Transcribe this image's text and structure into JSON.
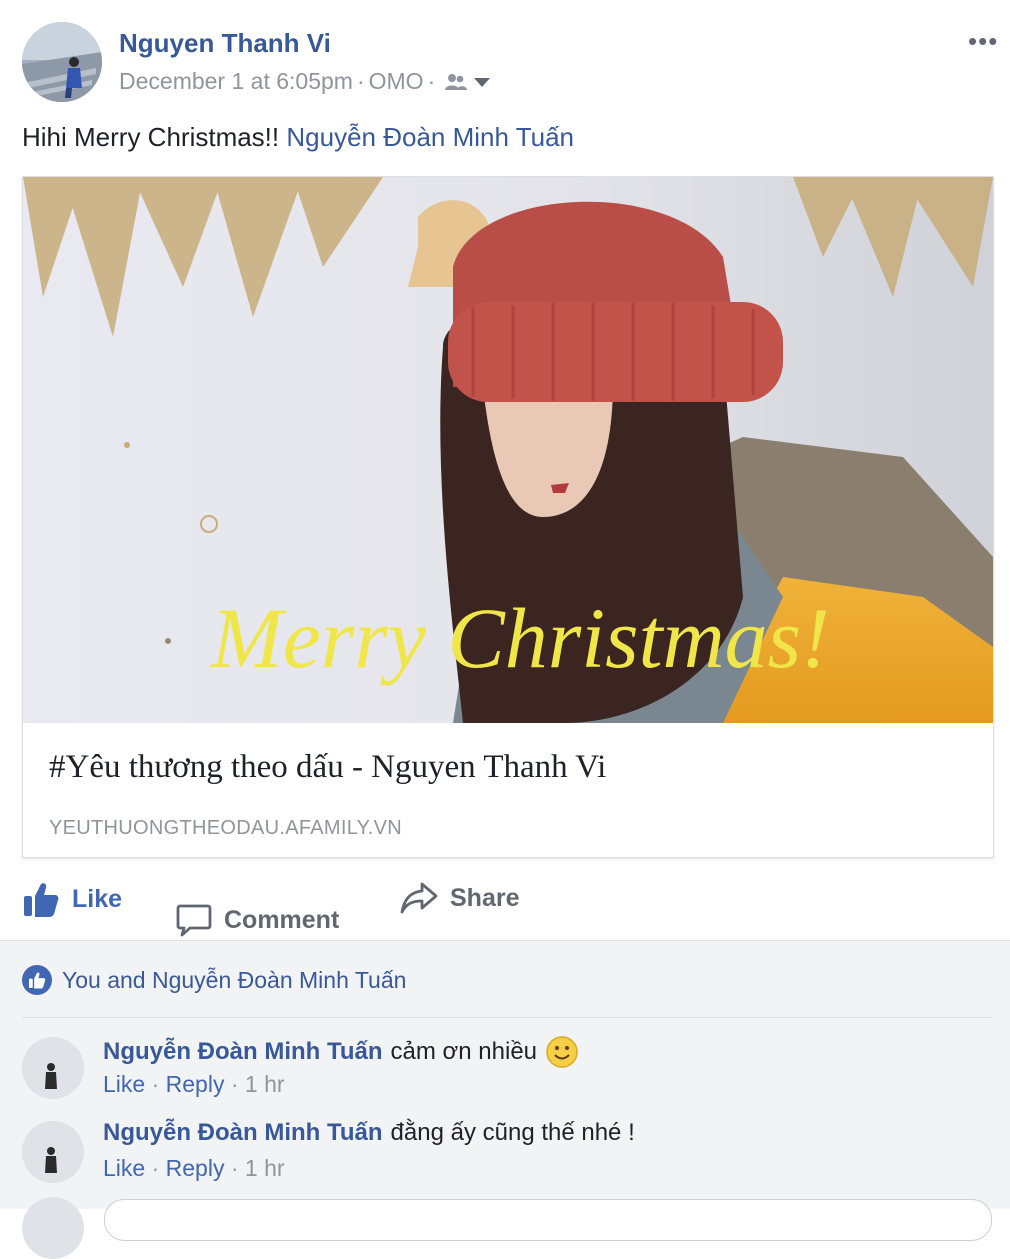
{
  "post": {
    "author": "Nguyen Thanh Vi",
    "timestamp": "December 1 at 6:05pm",
    "location": "OMO",
    "separator": "·",
    "audience_icon": "friends-icon",
    "more_icon": "more-options-icon",
    "text": "Hihi Merry Christmas!!",
    "mention": "Nguyễn Đoàn Minh Tuấn"
  },
  "link_card": {
    "image_overlay_text": "Merry Christmas!",
    "title": "#Yêu thương theo dấu - Nguyen Thanh Vi",
    "domain": "YEUTHUONGTHEODAU.AFAMILY.VN"
  },
  "actions": {
    "like_label": "Like",
    "comment_label": "Comment",
    "share_label": "Share"
  },
  "reactions": {
    "summary": "You and Nguyễn Đoàn Minh Tuấn"
  },
  "comments": [
    {
      "author": "Nguyễn Đoàn Minh Tuấn",
      "text": "cảm ơn nhiều",
      "has_emoji": true,
      "like_label": "Like",
      "reply_label": "Reply",
      "time": "1 hr",
      "dot": "·"
    },
    {
      "author": "Nguyễn Đoàn Minh Tuấn",
      "text": "đằng ấy cũng thế nhé !",
      "has_emoji": false,
      "like_label": "Like",
      "reply_label": "Reply",
      "time": "1 hr",
      "dot": "·"
    }
  ],
  "colors": {
    "link_blue": "#385898",
    "action_blue": "#4267b2",
    "meta_gray": "#90949c",
    "feedback_bg": "#f2f3f5",
    "merry_yellow": "#f0e64a"
  }
}
